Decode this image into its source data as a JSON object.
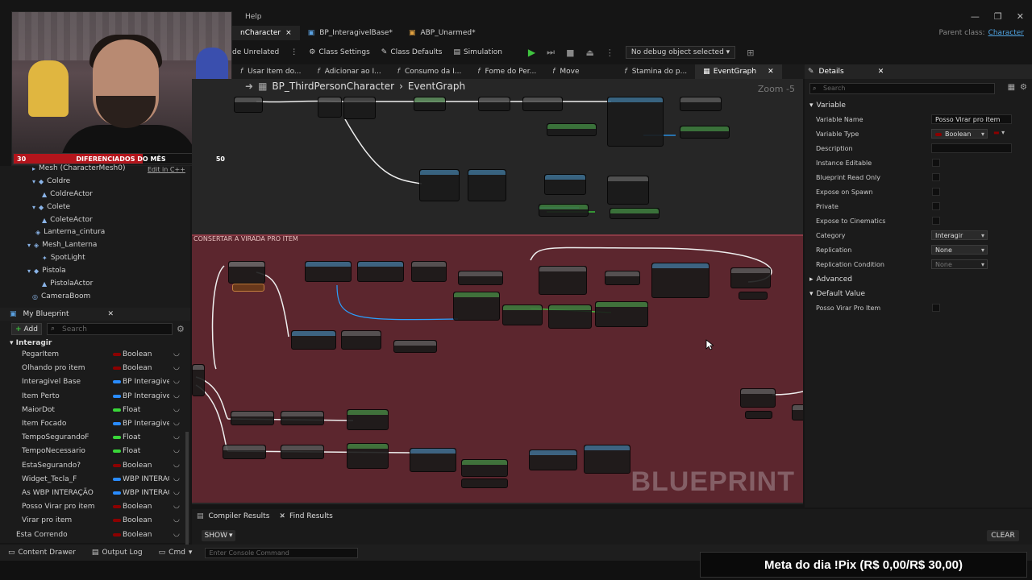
{
  "menu": {
    "help": "Help"
  },
  "tabs": [
    {
      "label": "nCharacter",
      "close": "×"
    },
    {
      "label": "BP_InteragivelBase*",
      "close": ""
    },
    {
      "label": "ABP_Unarmed*",
      "close": ""
    }
  ],
  "parent_class": {
    "label": "Parent class:",
    "value": "Character"
  },
  "toolbar": {
    "unrelated": "de Unrelated",
    "class_settings": "Class Settings",
    "class_defaults": "Class Defaults",
    "simulation": "Simulation",
    "debug_object": "No debug object selected"
  },
  "graph_tabs": [
    "Usar Item do...",
    "Adicionar ao I...",
    "Consumo da I...",
    "Fome do Per...",
    "Move",
    "Stamina do p...",
    "EventGraph"
  ],
  "graph": {
    "breadcrumb_class": "BP_ThirdPersonCharacter",
    "breadcrumb_graph": "EventGraph",
    "zoom": "Zoom -5",
    "comment_title": "CONSERTAR A VIRADA PRO ITEM",
    "watermark": "BLUEPRINT"
  },
  "stream_overlay": {
    "progress_current": "30",
    "progress_label": "DIFERENCIADOS DO MÊS",
    "progress_target": "50",
    "progress_fraction": 0.6,
    "goal_text": "Meta do dia !Pix (R$ 0,00/R$ 30,00)"
  },
  "components": [
    {
      "label": "Mesh (CharacterMesh0)",
      "edit": "Edit in C++"
    },
    {
      "label": "Coldre"
    },
    {
      "label": "ColdreActor"
    },
    {
      "label": "Colete"
    },
    {
      "label": "ColeteActor"
    },
    {
      "label": "Lanterna_cintura"
    },
    {
      "label": "Mesh_Lanterna"
    },
    {
      "label": "SpotLight"
    },
    {
      "label": "Pistola"
    },
    {
      "label": "PistolaActor"
    },
    {
      "label": "CameraBoom"
    }
  ],
  "my_blueprint": {
    "title": "My Blueprint",
    "add": "Add",
    "search_placeholder": "Search",
    "category": "Interagir",
    "variables": [
      {
        "name": "PegarItem",
        "type": "Boolean",
        "color": "#8c0000"
      },
      {
        "name": "Olhando pro item",
        "type": "Boolean",
        "color": "#8c0000"
      },
      {
        "name": "Interagivel Base",
        "type": "BP Interagivel E",
        "color": "#2a8cff"
      },
      {
        "name": "Item Perto",
        "type": "BP Interagivel E",
        "color": "#2a8cff"
      },
      {
        "name": "MaiorDot",
        "type": "Float",
        "color": "#39d639"
      },
      {
        "name": "Item Focado",
        "type": "BP Interagivel E",
        "color": "#2a8cff"
      },
      {
        "name": "TempoSegurandoF",
        "type": "Float",
        "color": "#39d639"
      },
      {
        "name": "TempoNecessario",
        "type": "Float",
        "color": "#39d639"
      },
      {
        "name": "EstaSegurando?",
        "type": "Boolean",
        "color": "#8c0000"
      },
      {
        "name": "Widget_Tecla_F",
        "type": "WBP INTERAÇÃ",
        "color": "#2a8cff"
      },
      {
        "name": "As WBP INTERAÇÃO",
        "type": "WBP INTERAÇÃ",
        "color": "#2a8cff"
      },
      {
        "name": "Posso Virar pro item",
        "type": "Boolean",
        "color": "#8c0000"
      },
      {
        "name": "Virar pro item",
        "type": "Boolean",
        "color": "#8c0000"
      },
      {
        "name": "Esta Correndo",
        "type": "Boolean",
        "color": "#8c0000"
      }
    ]
  },
  "details": {
    "title": "Details",
    "search_placeholder": "Search",
    "section_variable": "Variable",
    "props": {
      "variable_name_label": "Variable Name",
      "variable_name_value": "Posso Virar pro item",
      "variable_type_label": "Variable Type",
      "variable_type_value": "Boolean",
      "description_label": "Description",
      "instance_editable_label": "Instance Editable",
      "blueprint_read_only_label": "Blueprint Read Only",
      "expose_on_spawn_label": "Expose on Spawn",
      "private_label": "Private",
      "expose_cinematics_label": "Expose to Cinematics",
      "category_label": "Category",
      "category_value": "Interagir",
      "replication_label": "Replication",
      "replication_value": "None",
      "replication_condition_label": "Replication Condition",
      "replication_condition_value": "None"
    },
    "section_advanced": "Advanced",
    "section_default": "Default Value",
    "default_label": "Posso Virar Pro Item"
  },
  "bottom": {
    "compiler_results": "Compiler Results",
    "find_results": "Find Results",
    "show": "SHOW",
    "clear": "CLEAR",
    "content_drawer": "Content Drawer",
    "output_log": "Output Log",
    "cmd": "Cmd",
    "console_placeholder": "Enter Console Command"
  }
}
